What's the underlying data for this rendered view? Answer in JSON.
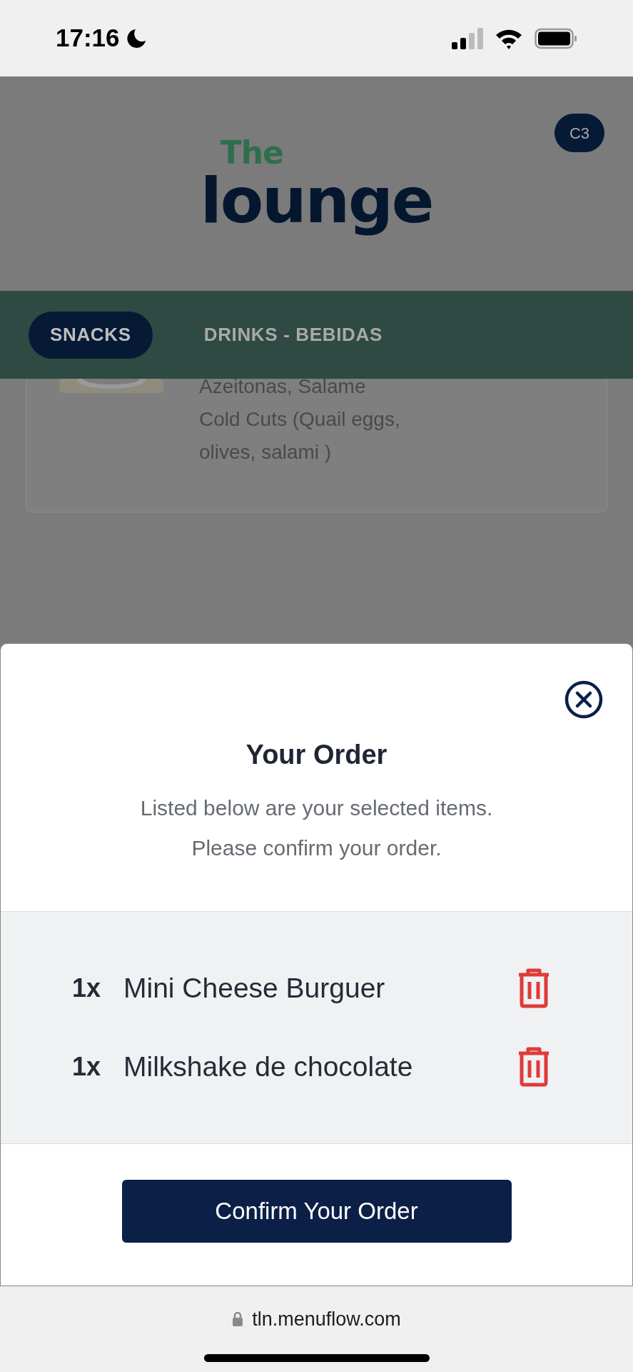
{
  "status_bar": {
    "time": "17:16"
  },
  "header": {
    "logo": {
      "top": "The",
      "bottom": "lounge"
    },
    "table_badge": "C3"
  },
  "tabs": [
    {
      "label": "SNACKS",
      "selected": true
    },
    {
      "label": "DRINKS - BEBIDAS",
      "selected": false
    }
  ],
  "menu_item": {
    "description": [
      "Azeitonas, Salame",
      "Cold Cuts (Quail eggs,",
      "olives, salami )"
    ]
  },
  "order_dialog": {
    "title": "Your Order",
    "subtitle": [
      "Listed below are your selected items.",
      "Please confirm your order."
    ],
    "items": [
      {
        "quantity": "1x",
        "name": "Mini Cheese Burguer"
      },
      {
        "quantity": "1x",
        "name": "Milkshake de chocolate"
      }
    ],
    "confirm_button": "Confirm Your Order"
  },
  "browser_bar": {
    "url": "tln.menuflow.com"
  }
}
